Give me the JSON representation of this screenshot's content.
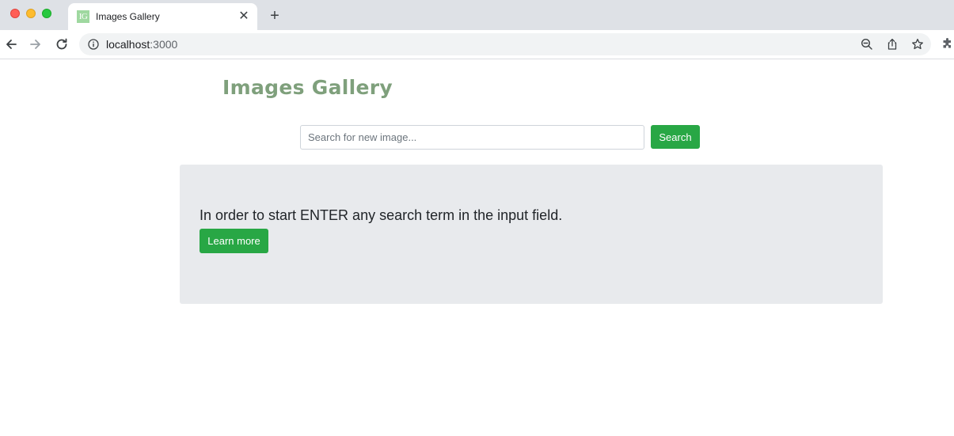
{
  "browser": {
    "tab": {
      "favicon_text": "IG",
      "title": "Images Gallery",
      "close_glyph": "✕"
    },
    "new_tab_glyph": "+",
    "address": {
      "host": "localhost",
      "port": ":3000"
    },
    "icons": [
      "back-icon",
      "forward-icon",
      "reload-icon",
      "info-icon",
      "zoom-out-icon",
      "share-icon",
      "bookmark-star-icon",
      "extensions-icon"
    ]
  },
  "page": {
    "brand": "Images Gallery",
    "search": {
      "placeholder": "Search for new image...",
      "value": "",
      "button_label": "Search"
    },
    "welcome": {
      "lead": "In order to start ENTER any search term in the input field.",
      "learn_more_label": "Learn more"
    },
    "colors": {
      "brand": "#7fa07c",
      "success": "#28a745",
      "jumbotron_bg": "#e8eaed"
    }
  }
}
